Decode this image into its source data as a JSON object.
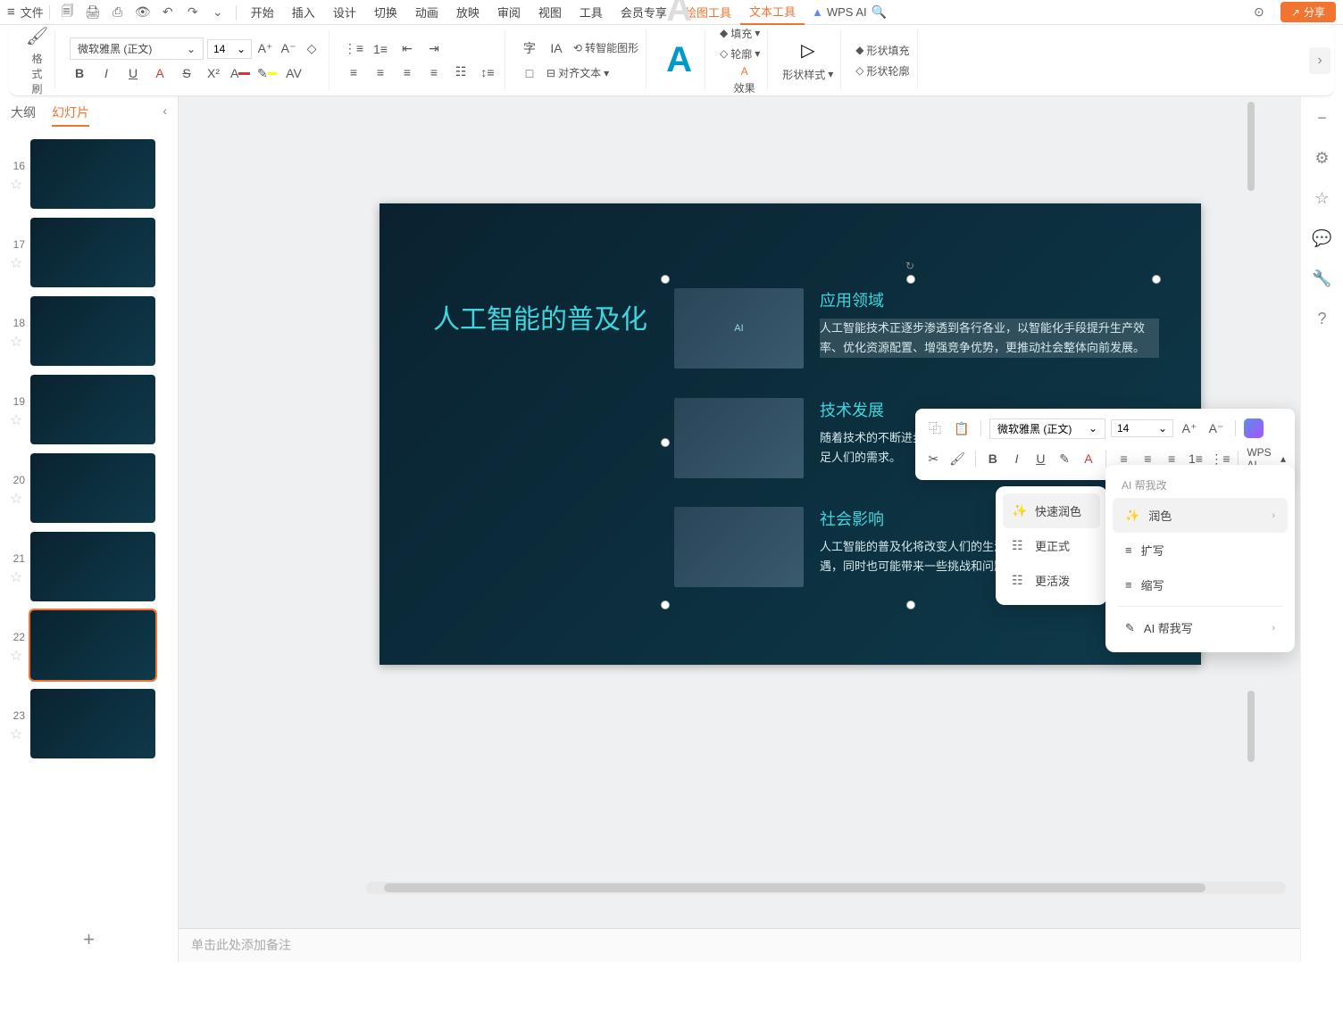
{
  "topbar": {
    "file": "文件",
    "tabs": [
      "开始",
      "插入",
      "设计",
      "切换",
      "动画",
      "放映",
      "审阅",
      "视图",
      "工具",
      "会员专享"
    ],
    "tool_tabs": {
      "drawing": "绘图工具",
      "text": "文本工具"
    },
    "ai_label": "WPS AI",
    "share": "分享"
  },
  "ribbon": {
    "format_brush": "格式刷",
    "font_name": "微软雅黑 (正文)",
    "font_size": "14",
    "smart_shape": "转智能图形",
    "align_text": "对齐文本",
    "fill": "填充",
    "outline": "轮廓",
    "effect": "效果",
    "shape_style": "形状样式",
    "shape_fill": "形状填充",
    "shape_outline": "形状轮廓"
  },
  "side": {
    "outline": "大纲",
    "slides": "幻灯片",
    "nums": [
      "16",
      "17",
      "18",
      "19",
      "20",
      "21",
      "22",
      "23"
    ]
  },
  "slide": {
    "title": "人工智能的普及化",
    "items": [
      {
        "h": "应用领域",
        "p": "人工智能技术正逐步渗透到各行各业，以智能化手段提升生产效率、优化资源配置、增强竞争优势，更推动社会整体向前发展。"
      },
      {
        "h": "技术发展",
        "p": "随着技术的不断进步，人工智能将更加智能化、个性化，更好地满足人们的需求。"
      },
      {
        "h": "社会影响",
        "p": "人工智能的普及化将改变人们的生活方式，带来更多的便利和机遇，同时也可能带来一些挑战和问题。"
      }
    ]
  },
  "mini": {
    "font": "微软雅黑 (正文)",
    "size": "14",
    "ai": "WPS AI"
  },
  "ctx": {
    "quick": "快速润色",
    "formal": "更正式",
    "lively": "更活泼"
  },
  "ai_panel": {
    "help": "AI 帮我改",
    "polish": "润色",
    "expand": "扩写",
    "shorten": "缩写",
    "help_write": "AI 帮我写"
  },
  "notes_placeholder": "单击此处添加备注"
}
